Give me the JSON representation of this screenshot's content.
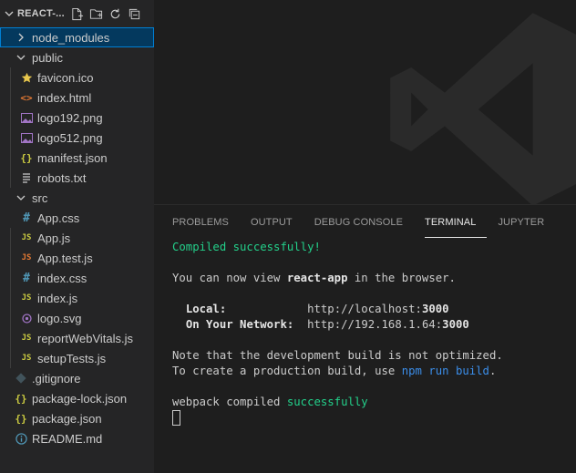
{
  "explorer": {
    "title": "REACT-...",
    "actions": [
      "new-file-icon",
      "new-folder-icon",
      "refresh-icon",
      "collapse-all-icon"
    ],
    "items": [
      {
        "label": "node_modules",
        "type": "folder-collapsed",
        "icon": "chevron-right-icon",
        "selected": true
      },
      {
        "label": "public",
        "type": "folder-expanded",
        "icon": "chevron-down-icon"
      },
      {
        "label": "favicon.ico",
        "type": "file",
        "icon": "star-icon",
        "color": "#e8c74d"
      },
      {
        "label": "index.html",
        "type": "file",
        "icon": "html-icon",
        "color": "#e37933"
      },
      {
        "label": "logo192.png",
        "type": "file",
        "icon": "image-icon",
        "color": "#a074c4"
      },
      {
        "label": "logo512.png",
        "type": "file",
        "icon": "image-icon",
        "color": "#a074c4"
      },
      {
        "label": "manifest.json",
        "type": "file",
        "icon": "json-icon",
        "color": "#cbcb41"
      },
      {
        "label": "robots.txt",
        "type": "file",
        "icon": "text-file-icon",
        "color": "#cccccc"
      },
      {
        "label": "src",
        "type": "folder-expanded",
        "icon": "chevron-down-icon"
      },
      {
        "label": "App.css",
        "type": "file",
        "icon": "css-icon",
        "color": "#519aba"
      },
      {
        "label": "App.js",
        "type": "file",
        "icon": "js-icon",
        "color": "#cbcb41"
      },
      {
        "label": "App.test.js",
        "type": "file",
        "icon": "js-icon",
        "color": "#e37933"
      },
      {
        "label": "index.css",
        "type": "file",
        "icon": "css-icon",
        "color": "#519aba"
      },
      {
        "label": "index.js",
        "type": "file",
        "icon": "js-icon",
        "color": "#cbcb41"
      },
      {
        "label": "logo.svg",
        "type": "file",
        "icon": "svg-icon",
        "color": "#a074c4"
      },
      {
        "label": "reportWebVitals.js",
        "type": "file",
        "icon": "js-icon",
        "color": "#cbcb41"
      },
      {
        "label": "setupTests.js",
        "type": "file",
        "icon": "js-icon",
        "color": "#cbcb41"
      },
      {
        "label": ".gitignore",
        "type": "file",
        "icon": "git-icon",
        "color": "#41535b"
      },
      {
        "label": "package-lock.json",
        "type": "file",
        "icon": "json-icon",
        "color": "#cbcb41"
      },
      {
        "label": "package.json",
        "type": "file",
        "icon": "json-icon",
        "color": "#cbcb41"
      },
      {
        "label": "README.md",
        "type": "file",
        "icon": "info-icon",
        "color": "#519aba"
      }
    ]
  },
  "panel": {
    "tabs": [
      {
        "label": "PROBLEMS",
        "active": false
      },
      {
        "label": "OUTPUT",
        "active": false
      },
      {
        "label": "DEBUG CONSOLE",
        "active": false
      },
      {
        "label": "TERMINAL",
        "active": true
      },
      {
        "label": "JUPYTER",
        "active": false
      }
    ]
  },
  "terminal": {
    "compiled": "Compiled successfully!",
    "view_prefix": "You can now view ",
    "app_name": "react-app",
    "view_suffix": " in the browser.",
    "local_label": "Local:",
    "local_url_prefix": "http://localhost:",
    "local_port": "3000",
    "network_label": "On Your Network:",
    "network_url_prefix": "http://192.168.1.64:",
    "network_port": "3000",
    "note_line": "Note that the development build is not optimized.",
    "prod_prefix": "To create a production build, use ",
    "prod_cmd": "npm run build",
    "prod_suffix": ".",
    "webpack_prefix": "webpack compiled ",
    "webpack_status": "successfully"
  }
}
